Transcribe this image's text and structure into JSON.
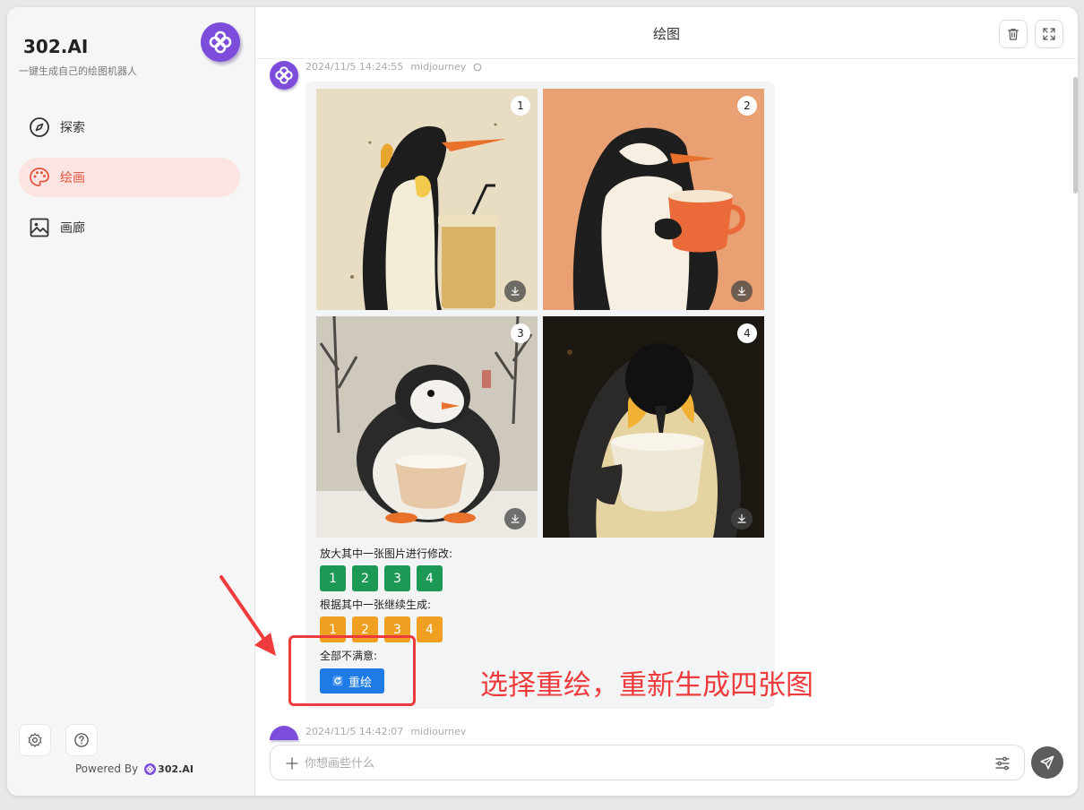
{
  "colors": {
    "brand_purple": "#7c4ddb",
    "active_nav_bg": "#fbe4e2",
    "active_nav_text": "#e4573e",
    "upscale_green": "#1c9a55",
    "variation_orange": "#f0a020",
    "redraw_blue": "#1e7be6",
    "annotation_red": "#ef3b3b"
  },
  "sidebar": {
    "title": "302.AI",
    "subtitle": "一键生成自己的绘图机器人",
    "logo_icon": "flower-logo-icon",
    "nav": [
      {
        "label": "探索",
        "icon": "compass-icon",
        "active": false
      },
      {
        "label": "绘画",
        "icon": "palette-icon",
        "active": true
      },
      {
        "label": "画廊",
        "icon": "image-icon",
        "active": false
      }
    ],
    "bottom_buttons": [
      {
        "icon": "settings-icon"
      },
      {
        "icon": "help-icon"
      }
    ],
    "powered_by": "Powered By",
    "powered_brand": "302.AI"
  },
  "header": {
    "title": "绘图",
    "buttons": [
      {
        "icon": "trash-icon"
      },
      {
        "icon": "fullscreen-icon"
      }
    ]
  },
  "messages": [
    {
      "timestamp": "2024/11/5 14:24:55",
      "model": "midjourney",
      "images": [
        {
          "number": "1",
          "subject": "penguin with iced drink"
        },
        {
          "number": "2",
          "subject": "penguin with orange mug"
        },
        {
          "number": "3",
          "subject": "round penguin in snow with cup"
        },
        {
          "number": "4",
          "subject": "penguin drinking from cup"
        }
      ],
      "upscale_label": "放大其中一张图片进行修改:",
      "upscale_buttons": [
        "1",
        "2",
        "3",
        "4"
      ],
      "variation_label": "根据其中一张继续生成:",
      "variation_buttons": [
        "1",
        "2",
        "3",
        "4"
      ],
      "reroll_label": "全部不满意:",
      "reroll_button": "重绘"
    },
    {
      "timestamp": "2024/11/5 14:42:07",
      "model": "midjourney"
    }
  ],
  "input": {
    "placeholder": "你想画些什么"
  },
  "annotation": {
    "text": "选择重绘，重新生成四张图"
  }
}
